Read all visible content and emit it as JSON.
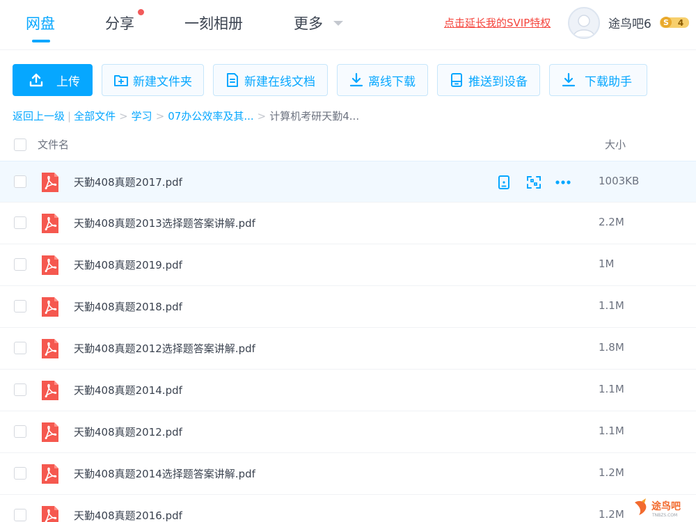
{
  "nav": {
    "items": [
      {
        "label": "网盘"
      },
      {
        "label": "分享"
      },
      {
        "label": "一刻相册"
      },
      {
        "label": "更多"
      }
    ],
    "svip_link": "点击延长我的SVIP特权",
    "username": "途鸟吧6",
    "badge_number": "4",
    "badge_symbol": "S"
  },
  "toolbar": {
    "upload": "上传",
    "new_folder": "新建文件夹",
    "new_doc": "新建在线文档",
    "offline_download": "离线下载",
    "push_device": "推送到设备",
    "download_assistant": "下载助手"
  },
  "breadcrumb": {
    "back": "返回上一级",
    "items": [
      "全部文件",
      "学习",
      "07办公效率及其...",
      "计算机考研天勤4..."
    ]
  },
  "table": {
    "col_name": "文件名",
    "col_size": "大小",
    "rows": [
      {
        "name": "天勤408真题2017.pdf",
        "size": "1003KB"
      },
      {
        "name": "天勤408真题2013选择题答案讲解.pdf",
        "size": "2.2M"
      },
      {
        "name": "天勤408真题2019.pdf",
        "size": "1M"
      },
      {
        "name": "天勤408真题2018.pdf",
        "size": "1.1M"
      },
      {
        "name": "天勤408真题2012选择题答案讲解.pdf",
        "size": "1.8M"
      },
      {
        "name": "天勤408真题2014.pdf",
        "size": "1.1M"
      },
      {
        "name": "天勤408真题2012.pdf",
        "size": "1.1M"
      },
      {
        "name": "天勤408真题2014选择题答案讲解.pdf",
        "size": "1.2M"
      },
      {
        "name": "天勤408真题2016.pdf",
        "size": "1.2M"
      }
    ]
  },
  "watermark": {
    "text": "途鸟吧",
    "sub": "TNBZS.COM"
  },
  "colors": {
    "accent": "#06a7ff",
    "pdf": "#f5584f",
    "svip": "#f5453d"
  }
}
